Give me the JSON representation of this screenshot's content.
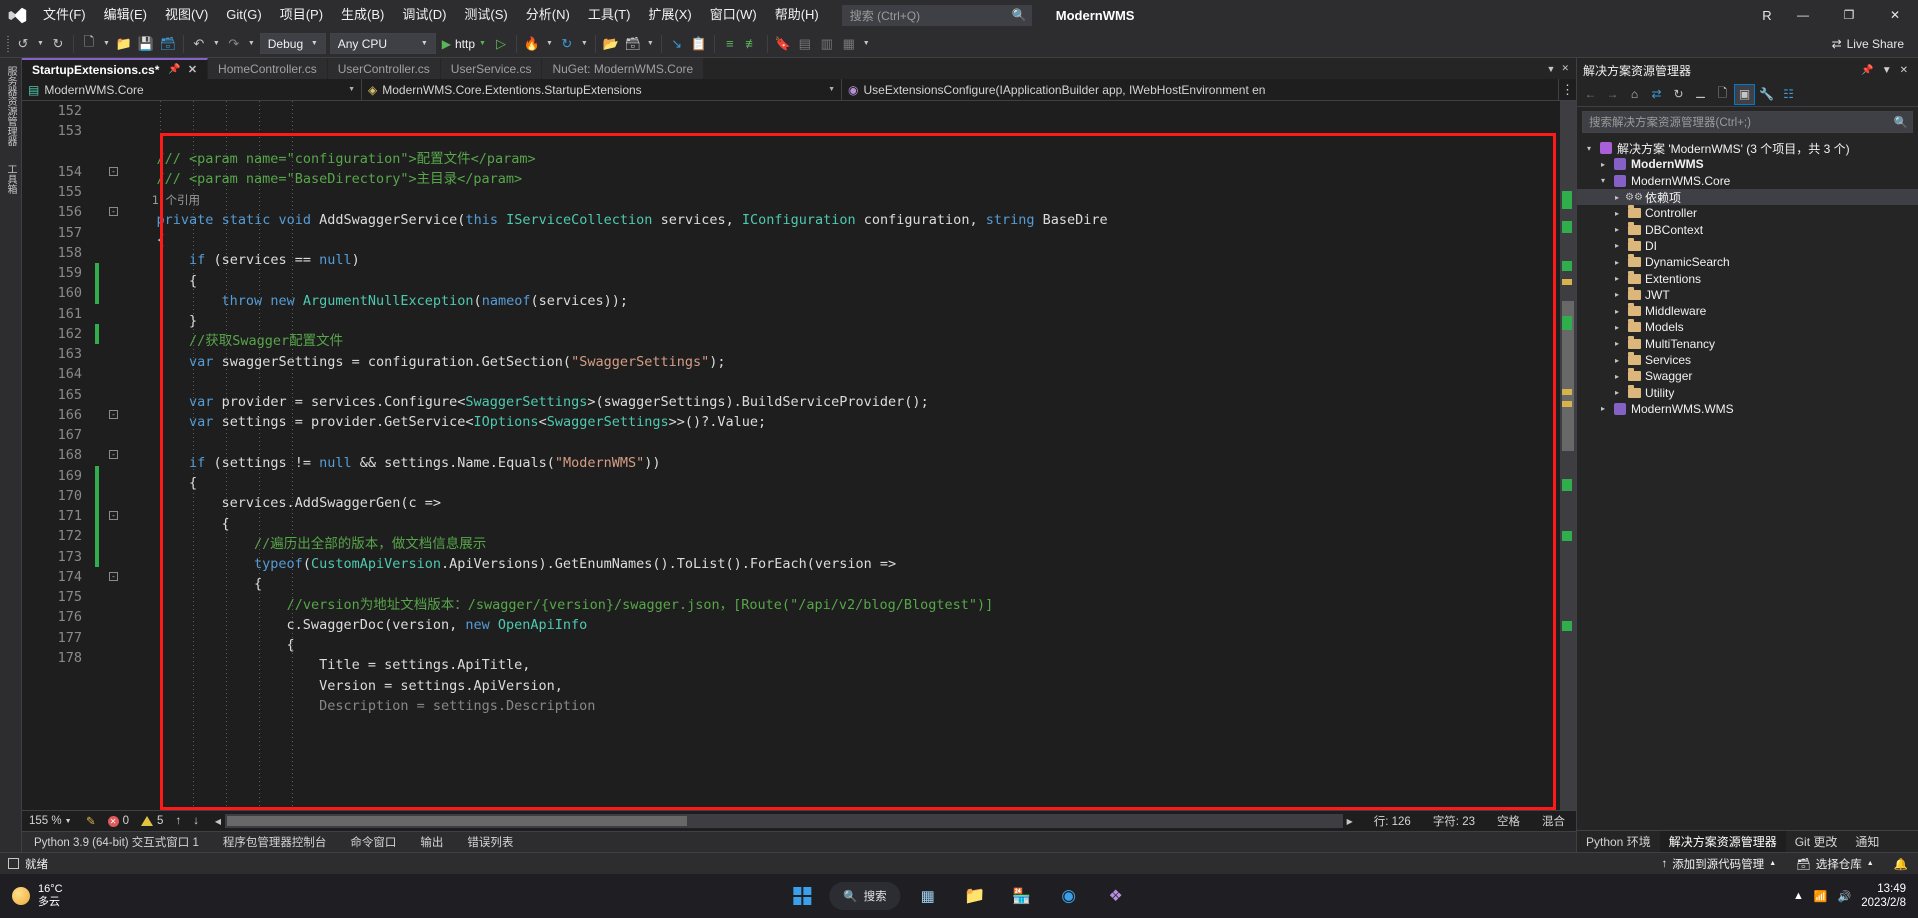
{
  "titlebar": {
    "logo_icon": "visual-studio-logo",
    "menus": [
      {
        "label": "文件(F)"
      },
      {
        "label": "编辑(E)"
      },
      {
        "label": "视图(V)"
      },
      {
        "label": "Git(G)"
      },
      {
        "label": "项目(P)"
      },
      {
        "label": "生成(B)"
      },
      {
        "label": "调试(D)"
      },
      {
        "label": "测试(S)"
      },
      {
        "label": "分析(N)"
      },
      {
        "label": "工具(T)"
      },
      {
        "label": "扩展(X)"
      },
      {
        "label": "窗口(W)"
      },
      {
        "label": "帮助(H)"
      }
    ],
    "search_placeholder": "搜索 (Ctrl+Q)",
    "search_icon": "search-icon",
    "project_name": "ModernWMS",
    "account_initial": "R",
    "window_buttons": {
      "minimize": "—",
      "maximize": "❐",
      "close": "✕"
    }
  },
  "toolbar": {
    "nav_back_icon": "navigate-back-icon",
    "nav_forward_icon": "navigate-forward-icon",
    "new_project_icon": "new-project-icon",
    "open_file_icon": "open-file-icon",
    "save_icon": "save-icon",
    "save_all_icon": "save-all-icon",
    "undo_icon": "undo-icon",
    "redo_icon": "redo-icon",
    "config_value": "Debug",
    "platform_value": "Any CPU",
    "run_icon": "run-start-icon",
    "run_label": "http",
    "run_nodebug_icon": "start-without-debugging-icon",
    "hot_reload_icon": "hot-reload-icon",
    "refresh_icon": "refresh-icon",
    "folder_icon": "folder-icon",
    "window_layout_icon": "window-layout-icon",
    "step_icon": "step-into-icon",
    "compare_icon": "compare-icon",
    "indent_icon": "indent-icon",
    "outdent_icon": "outdent-icon",
    "bookmark_icon": "bookmark-icon",
    "comment_icon": "comment-icon",
    "uncomment_icon": "uncomment-icon",
    "more_icon": "overflow-icon",
    "live_share_label": "Live Share",
    "live_share_icon": "live-share-icon"
  },
  "document_tabs": [
    {
      "label": "StartupExtensions.cs*",
      "active": true,
      "pin_icon": "pin-icon",
      "close_icon": "close-icon"
    },
    {
      "label": "HomeController.cs",
      "active": false
    },
    {
      "label": "UserController.cs",
      "active": false
    },
    {
      "label": "UserService.cs",
      "active": false
    },
    {
      "label": "NuGet: ModernWMS.Core",
      "active": false
    }
  ],
  "left_strip": [
    {
      "label": "服务器资源管理器"
    },
    {
      "label": "工具箱"
    }
  ],
  "navbar": [
    {
      "label": "ModernWMS.Core",
      "icon": "project-icon"
    },
    {
      "label": "ModernWMS.Core.Extentions.StartupExtensions",
      "icon": "class-icon"
    },
    {
      "label": "UseExtensionsConfigure(IApplicationBuilder app, IWebHostEnvironment en",
      "icon": "method-icon"
    }
  ],
  "code": {
    "first_line_number": 152,
    "lines": [
      {
        "n": 152,
        "html": "<span class=\"xml\">    /// &lt;param name=</span><span class=\"xml\">\"configuration\"</span><span class=\"xml\">&gt;配置文件&lt;/param&gt;</span>"
      },
      {
        "n": 153,
        "html": "<span class=\"xml\">    /// &lt;param name=</span><span class=\"xml\">\"BaseDirectory\"</span><span class=\"xml\">&gt;主目录&lt;/param&gt;</span>"
      },
      {
        "n": null,
        "ref": "    1 个引用"
      },
      {
        "n": 154,
        "fold": true,
        "html": "<span class=\"plain\">    </span><span class=\"kw\">private</span> <span class=\"kw\">static</span> <span class=\"kw\">void</span> <span class=\"plain\">AddSwaggerService(</span><span class=\"kw\">this</span> <span class=\"typ\">IServiceCollection</span> <span class=\"plain\">services, </span><span class=\"typ\">IConfiguration</span> <span class=\"plain\">configuration, </span><span class=\"kw\">string</span> <span class=\"plain\">BaseDire</span>"
      },
      {
        "n": 155,
        "html": "<span class=\"plain\">    {</span>"
      },
      {
        "n": 156,
        "fold": true,
        "html": "<span class=\"plain\">        </span><span class=\"kw\">if</span> <span class=\"plain\">(services == </span><span class=\"kw\">null</span><span class=\"plain\">)</span>"
      },
      {
        "n": 157,
        "html": "<span class=\"plain\">        {</span>"
      },
      {
        "n": 158,
        "html": "<span class=\"plain\">            </span><span class=\"kw\">throw</span> <span class=\"kw\">new</span> <span class=\"typ\">ArgumentNullException</span><span class=\"plain\">(</span><span class=\"kw\">nameof</span><span class=\"plain\">(services));</span>"
      },
      {
        "n": 159,
        "html": "<span class=\"plain\">        }</span>",
        "changed": true
      },
      {
        "n": 160,
        "html": "<span class=\"plain\">        </span><span class=\"cmt\">//获取Swagger配置文件</span>",
        "changed": true
      },
      {
        "n": 161,
        "html": "<span class=\"plain\">        </span><span class=\"kw\">var</span> <span class=\"plain\">swaggerSettings = configuration.GetSection(</span><span class=\"str\">\"SwaggerSettings\"</span><span class=\"plain\">);</span>"
      },
      {
        "n": 162,
        "html": "",
        "changed": true
      },
      {
        "n": 163,
        "html": "<span class=\"plain\">        </span><span class=\"kw\">var</span> <span class=\"plain\">provider = services.Configure&lt;</span><span class=\"typ\">SwaggerSettings</span><span class=\"plain\">&gt;(swaggerSettings).BuildServiceProvider();</span>"
      },
      {
        "n": 164,
        "html": "<span class=\"plain\">        </span><span class=\"kw\">var</span> <span class=\"plain\">settings = provider.GetService&lt;</span><span class=\"typ\">IOptions</span><span class=\"plain\">&lt;</span><span class=\"typ\">SwaggerSettings</span><span class=\"plain\">&gt;&gt;()?.Value;</span>"
      },
      {
        "n": 165,
        "html": ""
      },
      {
        "n": 166,
        "fold": true,
        "html": "<span class=\"plain\">        </span><span class=\"kw\">if</span> <span class=\"plain\">(settings != </span><span class=\"kw\">null</span> <span class=\"plain\">&amp;&amp; settings.Name.Equals(</span><span class=\"str\">\"ModernWMS\"</span><span class=\"plain\">))</span>"
      },
      {
        "n": 167,
        "html": "<span class=\"plain\">        {</span>"
      },
      {
        "n": 168,
        "fold": true,
        "html": "<span class=\"plain\">            services.AddSwaggerGen(c =&gt;</span>"
      },
      {
        "n": 169,
        "html": "<span class=\"plain\">            {</span>",
        "changed": true
      },
      {
        "n": 170,
        "html": "<span class=\"plain\">                </span><span class=\"cmt\">//遍历出全部的版本，做文档信息展示</span>",
        "changed": true
      },
      {
        "n": 171,
        "fold": true,
        "html": "<span class=\"plain\">                </span><span class=\"kw\">typeof</span><span class=\"plain\">(</span><span class=\"typ\">CustomApiVersion</span><span class=\"plain\">.ApiVersions).GetEnumNames().ToList().ForEach(version =&gt;</span>",
        "changed": true
      },
      {
        "n": 172,
        "html": "<span class=\"plain\">                {</span>",
        "changed": true
      },
      {
        "n": 173,
        "html": "<span class=\"plain\">                    </span><span class=\"cmt\">//version为地址文档版本：/swagger/{version}/swagger.json，[Route(\"/api/v2/blog/Blogtest\")]</span>",
        "changed": true
      },
      {
        "n": 174,
        "fold": true,
        "html": "<span class=\"plain\">                    c.SwaggerDoc(version, </span><span class=\"kw\">new</span> <span class=\"typ\">OpenApiInfo</span>"
      },
      {
        "n": 175,
        "html": "<span class=\"plain\">                    {</span>"
      },
      {
        "n": 176,
        "html": "<span class=\"plain\">                        Title = settings.ApiTitle,</span>"
      },
      {
        "n": 177,
        "html": "<span class=\"plain\">                        Version = settings.ApiVersion,</span>"
      },
      {
        "n": 178,
        "html": "<span class=\"plain\">                        Description = settings.Description</span>",
        "dim": true
      }
    ]
  },
  "editor_status": {
    "zoom": "155 %",
    "error_count": "0",
    "warning_count": "5",
    "up_arrow": "↑",
    "down_arrow": "↓",
    "line_label": "行: 126",
    "col_label": "字符: 23",
    "spaces_label": "空格",
    "mix_label": "混合",
    "rename_icon": "rename-icon"
  },
  "solution_explorer": {
    "title": "解决方案资源管理器",
    "pin_icon": "pin-icon",
    "dropdown_icon": "chevron-down-icon",
    "close_icon": "close-icon",
    "toolbar_icons": [
      "back-icon",
      "forward-icon",
      "home-icon",
      "sync-with-active-document-icon",
      "refresh-icon",
      "collapse-all-icon",
      "show-all-files-icon",
      "view-class-diagram-icon",
      "properties-icon",
      "preview-selected-items-icon"
    ],
    "search_placeholder": "搜索解决方案资源管理器(Ctrl+;)",
    "search_icon": "search-icon",
    "tree": [
      {
        "depth": 0,
        "label": "解决方案 'ModernWMS' (3 个项目，共 3 个)",
        "icon": "solution-icon",
        "expander": "▾",
        "bold": false
      },
      {
        "depth": 1,
        "label": "ModernWMS",
        "icon": "project-icon",
        "expander": "▸",
        "bold": true
      },
      {
        "depth": 1,
        "label": "ModernWMS.Core",
        "icon": "project-icon",
        "expander": "▾",
        "bold": false
      },
      {
        "depth": 2,
        "label": "依赖项",
        "icon": "dependencies-icon",
        "expander": "▸",
        "selected": true
      },
      {
        "depth": 2,
        "label": "Controller",
        "icon": "folder-icon",
        "expander": "▸"
      },
      {
        "depth": 2,
        "label": "DBContext",
        "icon": "folder-icon",
        "expander": "▸"
      },
      {
        "depth": 2,
        "label": "DI",
        "icon": "folder-icon",
        "expander": "▸"
      },
      {
        "depth": 2,
        "label": "DynamicSearch",
        "icon": "folder-icon",
        "expander": "▸"
      },
      {
        "depth": 2,
        "label": "Extentions",
        "icon": "folder-icon",
        "expander": "▸"
      },
      {
        "depth": 2,
        "label": "JWT",
        "icon": "folder-icon",
        "expander": "▸"
      },
      {
        "depth": 2,
        "label": "Middleware",
        "icon": "folder-icon",
        "expander": "▸"
      },
      {
        "depth": 2,
        "label": "Models",
        "icon": "folder-icon",
        "expander": "▸"
      },
      {
        "depth": 2,
        "label": "MultiTenancy",
        "icon": "folder-icon",
        "expander": "▸"
      },
      {
        "depth": 2,
        "label": "Services",
        "icon": "folder-icon",
        "expander": "▸"
      },
      {
        "depth": 2,
        "label": "Swagger",
        "icon": "folder-icon",
        "expander": "▸"
      },
      {
        "depth": 2,
        "label": "Utility",
        "icon": "folder-icon",
        "expander": "▸"
      },
      {
        "depth": 1,
        "label": "ModernWMS.WMS",
        "icon": "project-icon",
        "expander": "▸"
      }
    ],
    "bottom_tabs": [
      {
        "label": "Python 环境",
        "active": false
      },
      {
        "label": "解决方案资源管理器",
        "active": true
      },
      {
        "label": "Git 更改",
        "active": false
      },
      {
        "label": "通知",
        "active": false
      }
    ]
  },
  "dock_tabs": [
    {
      "label": "Python 3.9 (64-bit) 交互式窗口 1"
    },
    {
      "label": "程序包管理器控制台"
    },
    {
      "label": "命令窗口"
    },
    {
      "label": "输出"
    },
    {
      "label": "错误列表"
    }
  ],
  "vs_status": {
    "ready_label": "就绪",
    "ready_icon": "ready-icon",
    "add_source_control_label": "添加到源代码管理",
    "add_source_control_icon": "source-control-icon",
    "repo_label": "选择仓库",
    "repo_icon": "repository-icon",
    "up_icon": "↑"
  },
  "taskbar": {
    "weather_temp": "16°C",
    "weather_desc": "多云",
    "weather_icon": "sun-cloud-icon",
    "start_icon": "windows-start-icon",
    "search_label": "搜索",
    "search_icon": "search-icon",
    "apps": [
      {
        "name": "task-view-icon"
      },
      {
        "name": "file-explorer-icon"
      },
      {
        "name": "store-icon"
      },
      {
        "name": "edge-icon"
      },
      {
        "name": "visual-studio-icon"
      }
    ],
    "tray": {
      "chevron_icon": "show-hidden-icons-icon",
      "network_icon": "network-icon",
      "volume_icon": "volume-icon",
      "time": "13:49",
      "date": "2023/2/8"
    }
  },
  "annotation": {
    "rect_color": "#ff1a1a"
  }
}
